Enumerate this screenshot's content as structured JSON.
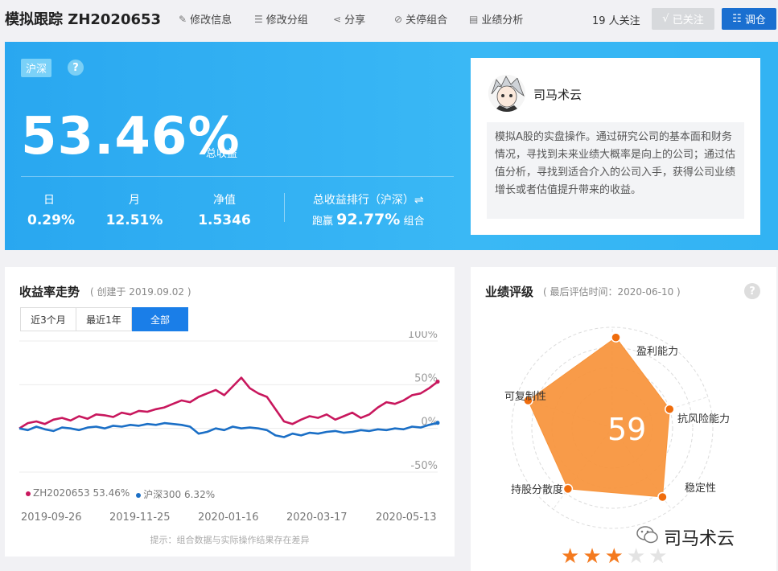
{
  "header": {
    "title": "模拟跟踪 ZH2020653",
    "tools": {
      "edit_info": "修改信息",
      "edit_group": "修改分组",
      "share": "分享",
      "close_portfolio": "关停组合",
      "performance": "业绩分析"
    },
    "follow_count": "19 人关注",
    "followed_label": "已关注",
    "rebalance_label": "调仓"
  },
  "hero": {
    "market_tag": "沪深",
    "help": "?",
    "total_return": "53.46%",
    "total_return_label": "总收益",
    "stats": [
      {
        "label": "日",
        "value": "0.29%"
      },
      {
        "label": "月",
        "value": "12.51%"
      },
      {
        "label": "净值",
        "value": "1.5346"
      }
    ],
    "rank_label": "总收益排行（沪深）⇌",
    "rank_prefix": "跑赢",
    "rank_value": "92.77%",
    "rank_suffix": "组合"
  },
  "profile": {
    "name": "司马术云",
    "description": "模拟A股的实盘操作。通过研究公司的基本面和财务情况，寻找到未来业绩大概率是向上的公司；通过估值分析，寻找到适合介入的公司入手，获得公司业绩增长或者估值提升带来的收益。"
  },
  "trend": {
    "title": "收益率走势",
    "created": "( 创建于 2019.09.02 )",
    "ranges": [
      "近3个月",
      "最近1年",
      "全部"
    ],
    "active_range": "全部",
    "note": "提示：组合数据与实际操作结果存在差异"
  },
  "rating": {
    "title": "业绩评级",
    "evaluated": "( 最后评估时间：2020-06-10 )",
    "help": "?",
    "score": "59",
    "dimensions": [
      "盈利能力",
      "抗风险能力",
      "稳定性",
      "持股分散度",
      "可复制性"
    ],
    "stars": 3,
    "max_stars": 5
  },
  "watermark": "司马术云",
  "colors": {
    "portfolio": "#c8175d",
    "index": "#1b6fc6",
    "accent": "#1a7ee8",
    "radar_fill": "#f7933a",
    "radar_point": "#ef6c0c"
  },
  "chart_data": {
    "type": "line",
    "x": [
      "2019-09-26",
      "2019-11-25",
      "2020-01-16",
      "2020-03-17",
      "2020-05-13"
    ],
    "y_ticks": [
      "100%",
      "50%",
      "0%",
      "-50%"
    ],
    "ylim": [
      -50,
      100
    ],
    "series": [
      {
        "name": "ZH2020653 53.46%",
        "color": "#c8175d",
        "values": [
          0,
          6,
          8,
          5,
          10,
          12,
          9,
          14,
          11,
          16,
          15,
          13,
          18,
          16,
          20,
          19,
          22,
          24,
          28,
          32,
          30,
          36,
          40,
          44,
          38,
          48,
          58,
          46,
          40,
          36,
          22,
          8,
          5,
          10,
          14,
          12,
          16,
          10,
          14,
          18,
          12,
          16,
          24,
          30,
          28,
          32,
          38,
          40,
          46,
          53.46
        ]
      },
      {
        "name": "沪深300 6.32%",
        "color": "#1b6fc6",
        "values": [
          0,
          -2,
          2,
          -1,
          -3,
          1,
          0,
          -2,
          1,
          2,
          0,
          3,
          2,
          4,
          3,
          5,
          4,
          6,
          5,
          4,
          2,
          -6,
          -4,
          0,
          -2,
          2,
          0,
          1,
          0,
          -2,
          -8,
          -10,
          -6,
          -8,
          -5,
          -6,
          -4,
          -3,
          -5,
          -4,
          -2,
          -3,
          -1,
          -2,
          0,
          -1,
          2,
          1,
          4,
          6.32
        ]
      }
    ]
  },
  "radar_data": {
    "type": "radar",
    "axes": [
      "盈利能力",
      "抗风险能力",
      "稳定性",
      "持股分散度",
      "可复制性"
    ],
    "values": [
      0.9,
      0.6,
      0.85,
      0.75,
      0.88
    ],
    "score": 59
  }
}
